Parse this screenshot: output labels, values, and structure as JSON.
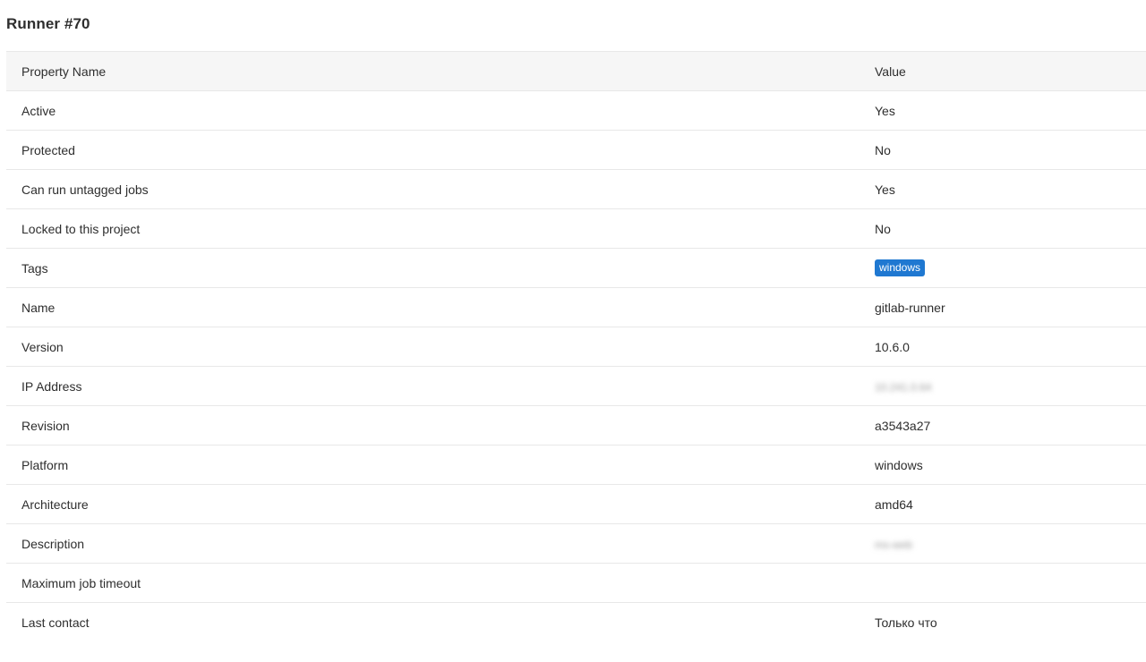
{
  "page": {
    "title": "Runner #70"
  },
  "table": {
    "headers": {
      "property": "Property Name",
      "value": "Value"
    },
    "rows": [
      {
        "property": "Active",
        "value": "Yes"
      },
      {
        "property": "Protected",
        "value": "No"
      },
      {
        "property": "Can run untagged jobs",
        "value": "Yes"
      },
      {
        "property": "Locked to this project",
        "value": "No"
      },
      {
        "property": "Tags",
        "tag": "windows"
      },
      {
        "property": "Name",
        "value": "gitlab-runner"
      },
      {
        "property": "Version",
        "value": "10.6.0"
      },
      {
        "property": "IP Address",
        "value": "10.241.0.64"
      },
      {
        "property": "Revision",
        "value": "a3543a27"
      },
      {
        "property": "Platform",
        "value": "windows"
      },
      {
        "property": "Architecture",
        "value": "amd64"
      },
      {
        "property": "Description",
        "value": "ms-web"
      },
      {
        "property": "Maximum job timeout",
        "value": ""
      },
      {
        "property": "Last contact",
        "value": "Только что"
      }
    ]
  },
  "colors": {
    "tag_badge": "#1f78d1",
    "header_row": "#f6f6f6",
    "row_border": "#e8e8e8"
  }
}
